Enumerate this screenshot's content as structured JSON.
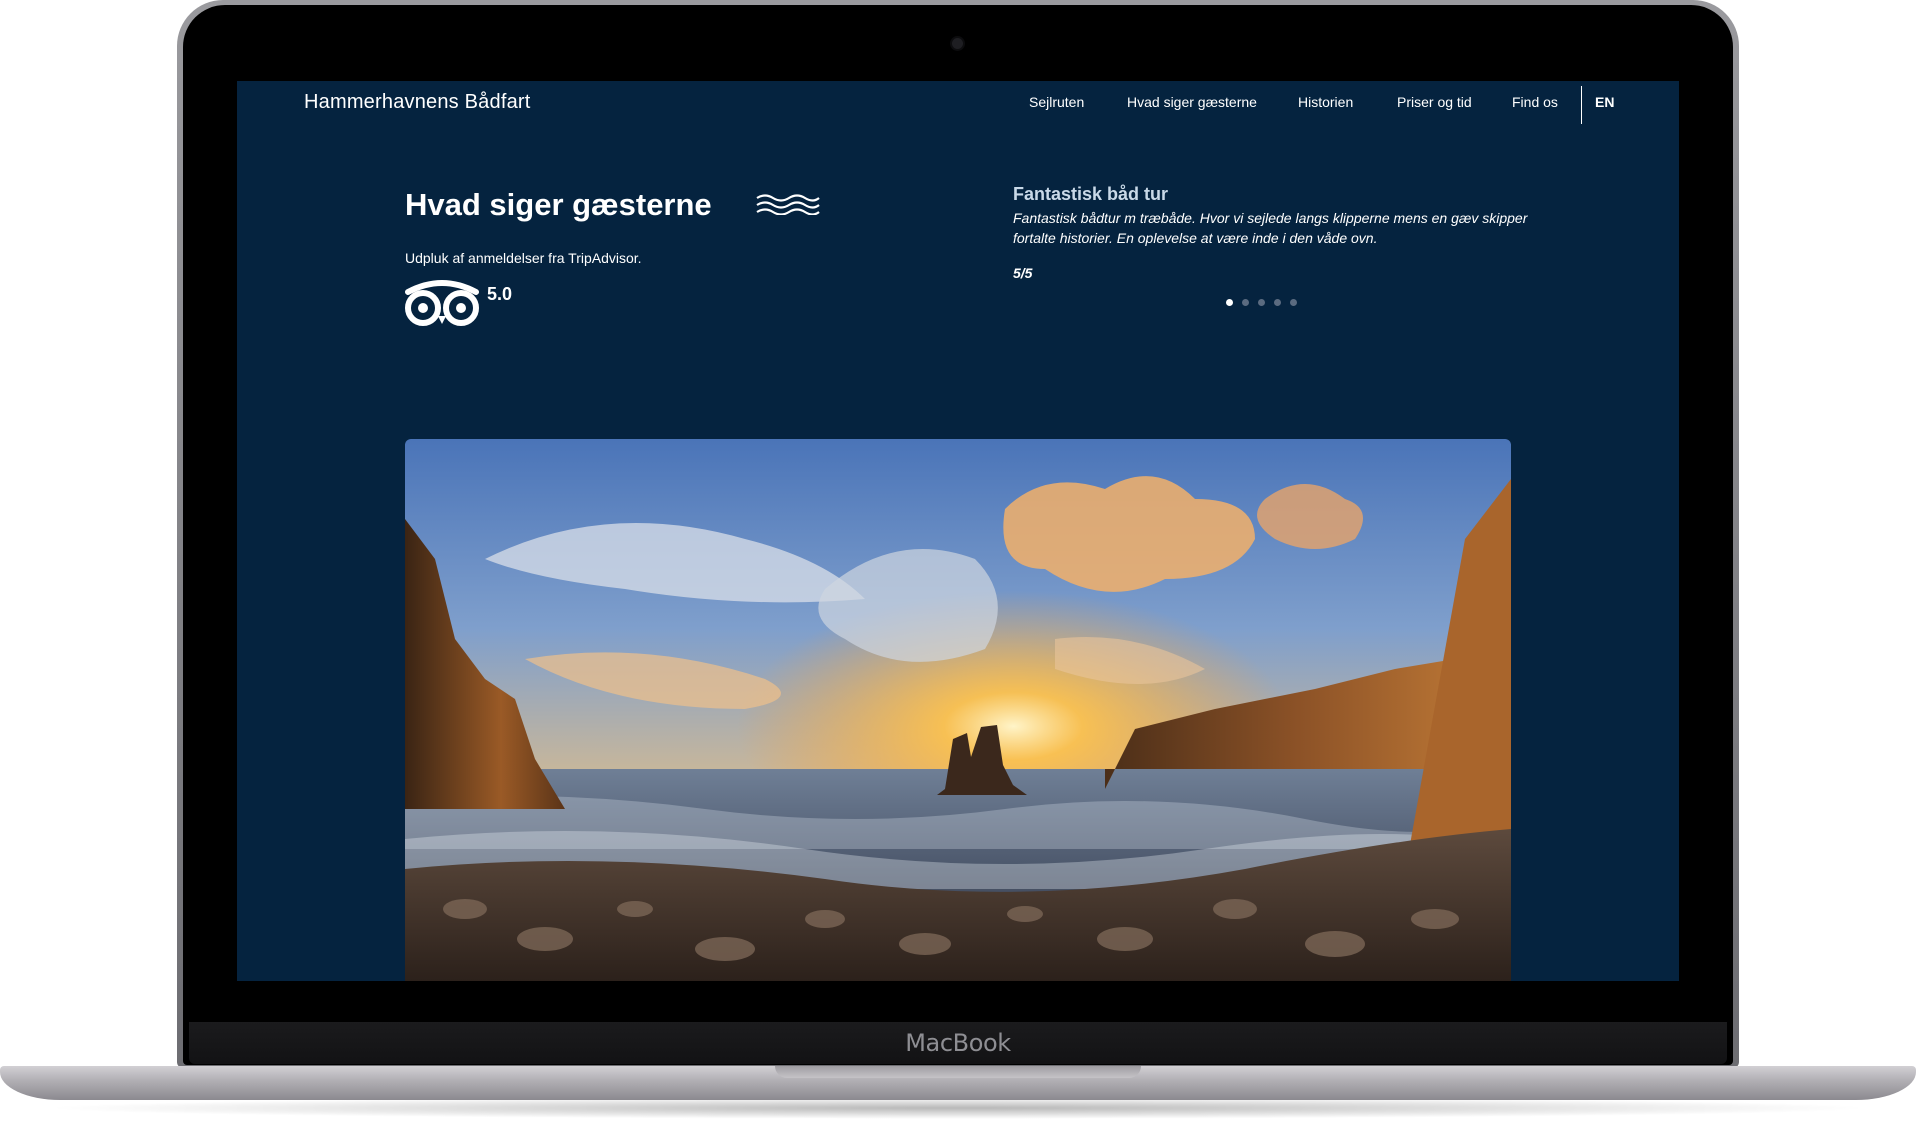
{
  "device": {
    "brand": "MacBook"
  },
  "site": {
    "title": "Hammerhavnens Bådfart"
  },
  "nav": {
    "items": [
      {
        "label": "Sejlruten"
      },
      {
        "label": "Hvad siger gæsterne"
      },
      {
        "label": "Historien"
      },
      {
        "label": "Priser og tid"
      },
      {
        "label": "Find os"
      }
    ],
    "language": "EN"
  },
  "reviews": {
    "heading": "Hvad siger gæsterne",
    "subtitle": "Udpluk af anmeldelser fra TripAdvisor.",
    "rating": "5.0",
    "current": {
      "title": "Fantastisk båd tur",
      "text": "Fantastisk bådtur m træbåde. Hvor vi sejlede langs klipperne mens en gæv skipper fortalte historier. En oplevelse at være inde i den våde ovn.",
      "score": "5/5"
    },
    "carousel": {
      "count": 5,
      "active_index": 0
    }
  },
  "colors": {
    "background": "#05233f",
    "review_title": "#c9d9e8",
    "text": "#ffffff"
  },
  "icons": [
    "waves-icon",
    "tripadvisor-owl-icon",
    "camera-icon"
  ]
}
